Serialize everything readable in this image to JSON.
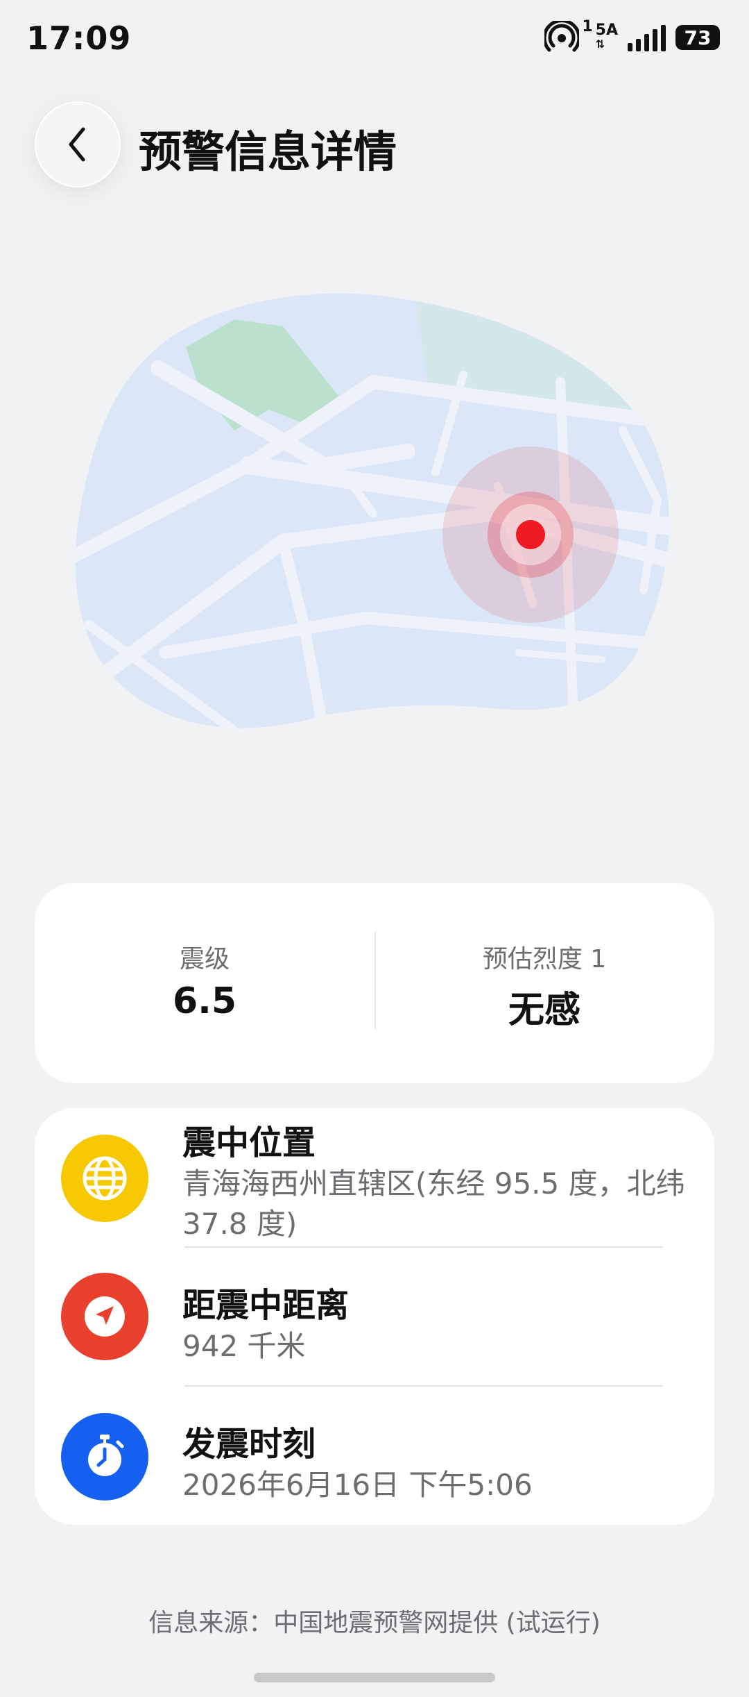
{
  "status_bar": {
    "time": "17:09",
    "hotspot_count": "1",
    "network": "5A",
    "battery": "73"
  },
  "header": {
    "title": "预警信息详情",
    "back_icon": "chevron-left-icon"
  },
  "magnitude_card": {
    "magnitude_label": "震级",
    "magnitude_value": "6.5",
    "intensity_label": "预估烈度 1",
    "intensity_value": "无感"
  },
  "info_card": {
    "rows": [
      {
        "icon": "globe-icon",
        "color": "#f5c800",
        "title": "震中位置",
        "value": "青海海西州直辖区(东经 95.5 度，北纬 37.8 度)"
      },
      {
        "icon": "navigation-arrow-icon",
        "color": "#e8402c",
        "title": "距震中距离",
        "value": "942 千米"
      },
      {
        "icon": "stopwatch-icon",
        "color": "#1560f0",
        "title": "发震时刻",
        "value": "2026年6月16日 下午5:06"
      }
    ]
  },
  "footer": {
    "source": "信息来源：中国地震预警网提供 (试运行)"
  },
  "colors": {
    "background": "#f1f2f4",
    "epicenter": "#e8202a",
    "map_land": "#dbe7f7",
    "map_park": "#b9e1cb"
  }
}
